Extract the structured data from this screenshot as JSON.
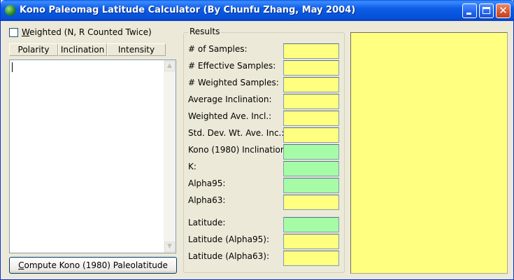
{
  "window": {
    "title": "Kono Paleomag Latitude Calculator (By Chunfu Zhang, May 2004)"
  },
  "weighted_checkbox": {
    "accel": "W",
    "rest": "eighted (N, R Counted Twice)",
    "checked": false
  },
  "table": {
    "columns": [
      "Polarity",
      "Inclination",
      "Intensity"
    ],
    "rows": []
  },
  "compute_button": {
    "prefix": "",
    "accel": "C",
    "rest": "ompute Kono (1980) Paleolatitude"
  },
  "results": {
    "legend": "Results",
    "labels": {
      "num_samples": "# of Samples:",
      "effective_samples": "# Effective Samples:",
      "weighted_samples": "# Weighted Samples:",
      "average_inclination": "Average Inclination:",
      "weighted_ave_incl": "Weighted Ave. Incl.:",
      "std_dev": "Std. Dev. Wt. Ave. Inc.:",
      "kono_inclination": "Kono (1980) Inclination:",
      "k": "K:",
      "alpha95": "Alpha95:",
      "alpha63": "Alpha63:",
      "latitude": "Latitude:",
      "latitude_alpha95": "Latitude (Alpha95):",
      "latitude_alpha63": "Latitude (Alpha63):"
    },
    "values": {
      "num_samples": "",
      "effective_samples": "",
      "weighted_samples": "",
      "average_inclination": "",
      "weighted_ave_incl": "",
      "std_dev": "",
      "kono_inclination": "",
      "k": "",
      "alpha95": "",
      "alpha63": "",
      "latitude": "",
      "latitude_alpha95": "",
      "latitude_alpha63": ""
    }
  },
  "colors": {
    "output_yellow": "#ffff80",
    "output_green": "#a6fca6",
    "titlebar_blue": "#0650d8"
  }
}
